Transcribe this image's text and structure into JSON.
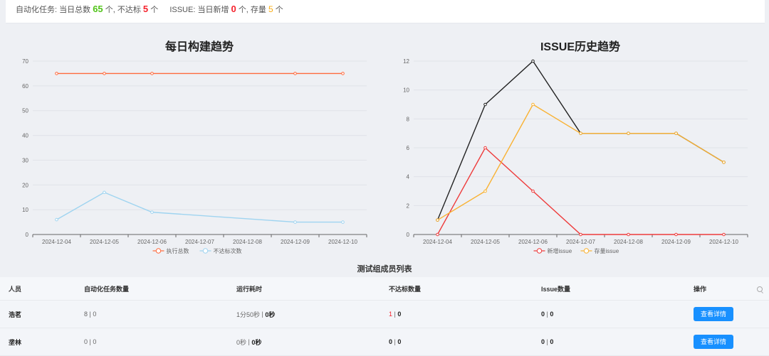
{
  "summary": {
    "auto_prefix": "自动化任务: 当日总数",
    "auto_total": "65",
    "unit_ge_1": "个, 不达标",
    "fail_count": "5",
    "unit_ge_2": "个",
    "issue_prefix": "ISSUE: 当日新增",
    "issue_new": "0",
    "unit_ge_3": "个, 存量",
    "issue_stock": "5",
    "unit_ge_4": "个"
  },
  "charts": {
    "build": {
      "title": "每日构建趋势"
    },
    "issue": {
      "title": "ISSUE历史趋势"
    }
  },
  "chart_data": [
    {
      "type": "line",
      "title": "每日构建趋势",
      "categories": [
        "2024-12-04",
        "2024-12-05",
        "2024-12-06",
        "2024-12-07",
        "2024-12-08",
        "2024-12-09",
        "2024-12-10"
      ],
      "ylim": [
        0,
        70
      ],
      "yticks": [
        0,
        10,
        20,
        30,
        40,
        50,
        60,
        70
      ],
      "grid": true,
      "legend": "bottom",
      "series": [
        {
          "name": "执行总数",
          "color": "#ff6a3d",
          "values": [
            65,
            65,
            65,
            null,
            null,
            65,
            65
          ]
        },
        {
          "name": "不达标次数",
          "color": "#9fd4f0",
          "values": [
            6,
            17,
            9,
            null,
            null,
            5,
            5
          ]
        }
      ]
    },
    {
      "type": "line",
      "title": "ISSUE历史趋势",
      "categories": [
        "2024-12-04",
        "2024-12-05",
        "2024-12-06",
        "2024-12-07",
        "2024-12-08",
        "2024-12-09",
        "2024-12-10"
      ],
      "ylim": [
        0,
        12
      ],
      "yticks": [
        0,
        2,
        4,
        6,
        8,
        10,
        12
      ],
      "grid": true,
      "legend": "bottom",
      "series": [
        {
          "name": "",
          "color": "#222222",
          "values": [
            1,
            9,
            12,
            7,
            7,
            7,
            5
          ]
        },
        {
          "name": "新增issue",
          "color": "#ee3b3b",
          "values": [
            0,
            6,
            3,
            0,
            0,
            0,
            0
          ]
        },
        {
          "name": "存量issue",
          "color": "#f9b233",
          "values": [
            1,
            3,
            9,
            7,
            7,
            7,
            5
          ]
        }
      ]
    }
  ],
  "table": {
    "title": "测试组成员列表",
    "headers": [
      "人员",
      "自动化任务数量",
      "运行耗时",
      "不达标数量",
      "Issue数量",
      "操作"
    ],
    "rows": [
      {
        "name": "浩茗",
        "tasks_a": "8",
        "tasks_b": "0",
        "time_a": "1分50秒",
        "time_b": "0秒",
        "fail_a": "1",
        "fail_b": "0",
        "issue_a": "0",
        "issue_b": "0",
        "action": "查看详情"
      },
      {
        "name": "垄林",
        "tasks_a": "0",
        "tasks_b": "0",
        "time_a": "0秒",
        "time_b": "0秒",
        "fail_a": "0",
        "fail_b": "0",
        "issue_a": "0",
        "issue_b": "0",
        "action": "查看详情"
      }
    ],
    "sep": "|"
  }
}
